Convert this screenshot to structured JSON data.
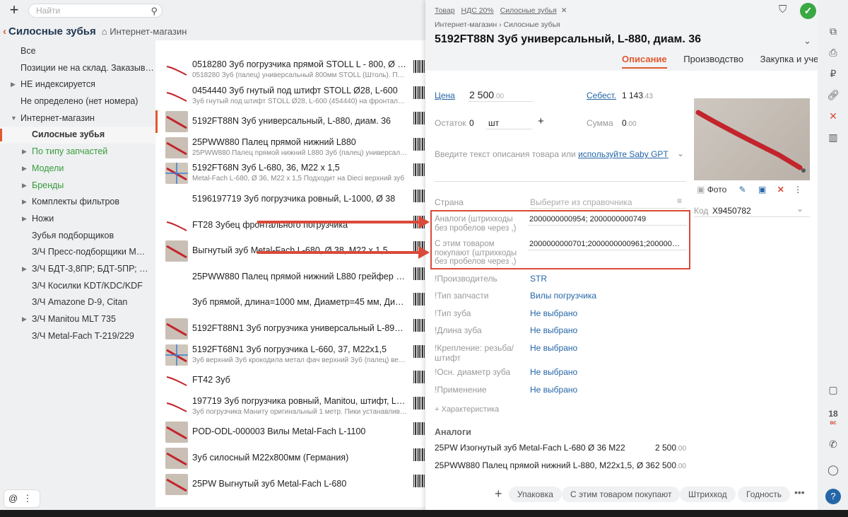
{
  "search": {
    "placeholder": "Найти"
  },
  "header": {
    "title": "Силосные зубья",
    "crumb": "Интернет-магазин"
  },
  "tree": [
    {
      "label": "Все",
      "indent": 0
    },
    {
      "label": "Позиции не на склад. Заказыв…",
      "indent": 0
    },
    {
      "label": "НЕ индексируется",
      "indent": 0,
      "arrow": "▶"
    },
    {
      "label": "Не определено (нет номера)",
      "indent": 0
    },
    {
      "label": "Интернет-магазин",
      "indent": 0,
      "arrow": "▼"
    },
    {
      "label": "Силосные зубья",
      "indent": 1,
      "selected": true
    },
    {
      "label": "По типу запчастей",
      "indent": 1,
      "arrow": "▶",
      "green": true
    },
    {
      "label": "Модели",
      "indent": 1,
      "arrow": "▶",
      "green": true
    },
    {
      "label": "Бренды",
      "indent": 1,
      "arrow": "▶",
      "green": true
    },
    {
      "label": "Комплекты фильтров",
      "indent": 1,
      "arrow": "▶"
    },
    {
      "label": "Ножи",
      "indent": 1,
      "arrow": "▶"
    },
    {
      "label": "Зубья подборщиков",
      "indent": 1
    },
    {
      "label": "З/Ч Пресс-подборщики М…",
      "indent": 1
    },
    {
      "label": "З/Ч БДТ-3,8ПР; БДТ-5ПР; …",
      "indent": 1,
      "arrow": "▶"
    },
    {
      "label": "З/Ч Косилки KDT/KDC/KDF",
      "indent": 1
    },
    {
      "label": "З/Ч Amazone D-9, Citan",
      "indent": 1
    },
    {
      "label": "З/Ч Manitou MLT 735",
      "indent": 1,
      "arrow": "▶"
    },
    {
      "label": "З/Ч Metal-Fach T-219/229",
      "indent": 1
    }
  ],
  "items": [
    {
      "title": "0518280 Зуб погрузчика прямой STOLL L - 800, Ø …",
      "sub": "0518280 Зуб (палец) универсальный 800мм STOLL (Штоль). Пики…",
      "thumb": "line"
    },
    {
      "title": "0454440 Зуб гнутый под штифт STOLL Ø28, L-600",
      "sub": "Зуб гнутый под штифт STOLL Ø28, L-600 (454440) на фронтальные…",
      "thumb": "line"
    },
    {
      "title": "5192FT88N Зуб универсальный, L-880, диам. 36",
      "sub": "",
      "thumb": "photo",
      "selected": true
    },
    {
      "title": "25PWW880 Палец прямой нижний L880",
      "sub": "25PWW880 Палец прямой нижний L880 Зуб (палец) универсальный 88…",
      "thumb": "photo"
    },
    {
      "title": "5192FT68N Зуб L-680, 36, M22 x 1,5",
      "sub": "Metal-Fach L-680, Ø 36, M22 x 1,5 Подходит на Dieci верхний зуб",
      "thumb": "blue"
    },
    {
      "title": "5196197719 Зуб погрузчика ровный, L-1000, Ø 38",
      "sub": "",
      "thumb": "none"
    },
    {
      "title": "FT28 Зубец фронтального погрузчика",
      "sub": "",
      "thumb": "line"
    },
    {
      "title": "Выгнутый зуб Metal-Fach L-680, Ø 38, M22 x 1,5",
      "sub": "",
      "thumb": "photo"
    },
    {
      "title": "25PWW880 Палец прямой нижний L880 грейфер д…",
      "sub": "",
      "thumb": "none"
    },
    {
      "title": "Зуб прямой, длина=1000 мм, Диаметр=45 мм, Диа…",
      "sub": "",
      "thumb": "none"
    },
    {
      "title": "5192FT88N1 Зуб погрузчика универсальный L-895…",
      "sub": "",
      "thumb": "photo"
    },
    {
      "title": "5192FT68N1 Зуб погрузчика L-660, 37, M22x1,5",
      "sub": "Зуб верхний Зуб крокодила метал фач верхний Зуб (палец) верхний…",
      "thumb": "blue"
    },
    {
      "title": "FT42 Зуб",
      "sub": "",
      "thumb": "line"
    },
    {
      "title": "197719 Зуб погрузчика ровный, Manitou, штифт, L-…",
      "sub": "Зуб погрузчика Маниту оригинальный 1 метр. Пики устанавливаются …",
      "thumb": "line"
    },
    {
      "title": "POD-ODL-000003 Вилы Metal-Fach L-1100",
      "sub": "",
      "thumb": "photo"
    },
    {
      "title": "Зуб силосный M22x800мм (Германия)",
      "sub": "",
      "thumb": "photo"
    },
    {
      "title": "25PW Выгнутый зуб Metal-Fach L-680",
      "sub": "",
      "thumb": "photo"
    }
  ],
  "card": {
    "tags": [
      "Товар",
      "НДС 20%",
      "Силосные зубья"
    ],
    "crumb": "Интернет-магазин › Силосные зубья",
    "title": "5192FT88N Зуб универсальный, L-880, диам. 36",
    "tabs": [
      "Описание",
      "Производство",
      "Закупка и учет"
    ],
    "price_label": "Цена",
    "price": "2 500",
    "price_cents": ".00",
    "cost_label": "Себест.",
    "cost": "1 143",
    "cost_cents": ".43",
    "stock_label": "Остаток",
    "stock": "0",
    "unit": "шт",
    "sum_label": "Сумма",
    "sum": "0",
    "sum_cents": ".00",
    "desc_placeholder": "Введите текст описания товара или",
    "desc_link": "используйте Saby GPT",
    "photo_label": "Фото",
    "code_label": "Код",
    "code": "Х9450782",
    "country_label": "Страна",
    "country_placeholder": "Выберите из справочника",
    "analogs_label": "Аналоги (штрихкоды без пробелов через ,)",
    "analogs_value": "2000000000954; 2000000000749",
    "bought_label": "С этим товаром покупают (штрихкоды без пробелов через ,)",
    "bought_value": "2000000000701;2000000000961;200000…",
    "props": [
      {
        "label": "!Производитель",
        "value": "STR"
      },
      {
        "label": "!Тип запчасти",
        "value": "Вилы погрузчика"
      },
      {
        "label": "!Тип зуба",
        "value": "Не выбрано"
      },
      {
        "label": "!Длина зуба",
        "value": "Не выбрано"
      },
      {
        "label": "!Крепление: резьба/штифт",
        "value": "Не выбрано"
      },
      {
        "label": "!Осн. диаметр зуба",
        "value": "Не выбрано"
      },
      {
        "label": "!Применение",
        "value": "Не выбрано"
      }
    ],
    "add_char": "+ Характеристика",
    "analogs_section": "Аналоги",
    "analog_rows": [
      {
        "name": "25PW Изогнутый зуб Metal-Fach L-680 Ø 36 M22",
        "price": "2 500",
        "cents": ".00"
      },
      {
        "name": "25PWW880 Палец прямой нижний L-880, M22x1,5, Ø 36",
        "price": "2 500",
        "cents": ".00"
      }
    ],
    "chips": [
      "Упаковка",
      "С этим товаром покупают",
      "Штрихкод",
      "Годность"
    ]
  },
  "rightbar": {
    "date_day": "18",
    "date_sub": "вс"
  },
  "colors": {
    "accent": "#e05a2d",
    "link": "#2566a8",
    "highlight": "#d94a3a",
    "ok": "#3aa843"
  }
}
